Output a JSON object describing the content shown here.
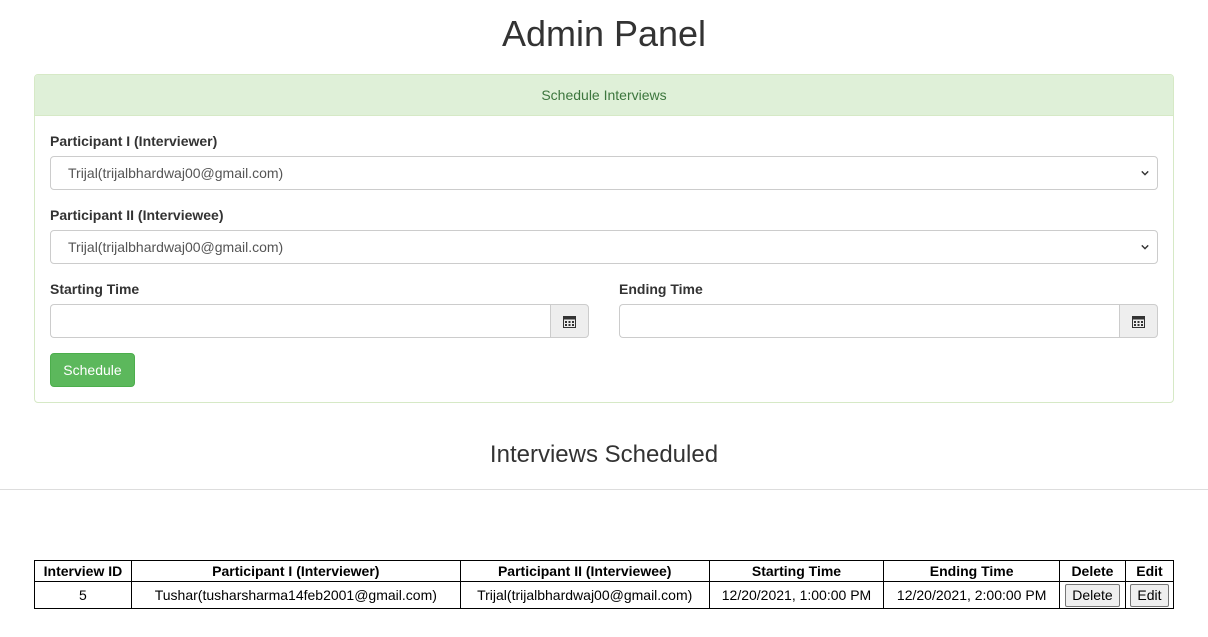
{
  "header": {
    "title": "Admin Panel"
  },
  "schedule_panel": {
    "heading": "Schedule Interviews",
    "participant1": {
      "label": "Participant I (Interviewer)",
      "selected": "Trijal(trijalbhardwaj00@gmail.com)"
    },
    "participant2": {
      "label": "Participant II (Interviewee)",
      "selected": "Trijal(trijalbhardwaj00@gmail.com)"
    },
    "start_time": {
      "label": "Starting Time",
      "value": ""
    },
    "end_time": {
      "label": "Ending Time",
      "value": ""
    },
    "schedule_button": "Schedule"
  },
  "interviews": {
    "title": "Interviews Scheduled",
    "columns": [
      "Interview ID",
      "Participant I (Interviewer)",
      "Participant II (Interviewee)",
      "Starting Time",
      "Ending Time",
      "Delete",
      "Edit"
    ],
    "rows": [
      {
        "id": "5",
        "participant1": "Tushar(tusharsharma14feb2001@gmail.com)",
        "participant2": "Trijal(trijalbhardwaj00@gmail.com)",
        "start": "12/20/2021, 1:00:00 PM",
        "end": "12/20/2021, 2:00:00 PM",
        "delete_label": "Delete",
        "edit_label": "Edit"
      }
    ]
  },
  "colors": {
    "panel_heading_bg": "#dff0d8",
    "panel_heading_text": "#3c763d",
    "success_button": "#5cb85c"
  },
  "icons": {
    "select_arrow": "chevron-down-icon",
    "date_picker": "calendar-icon"
  }
}
